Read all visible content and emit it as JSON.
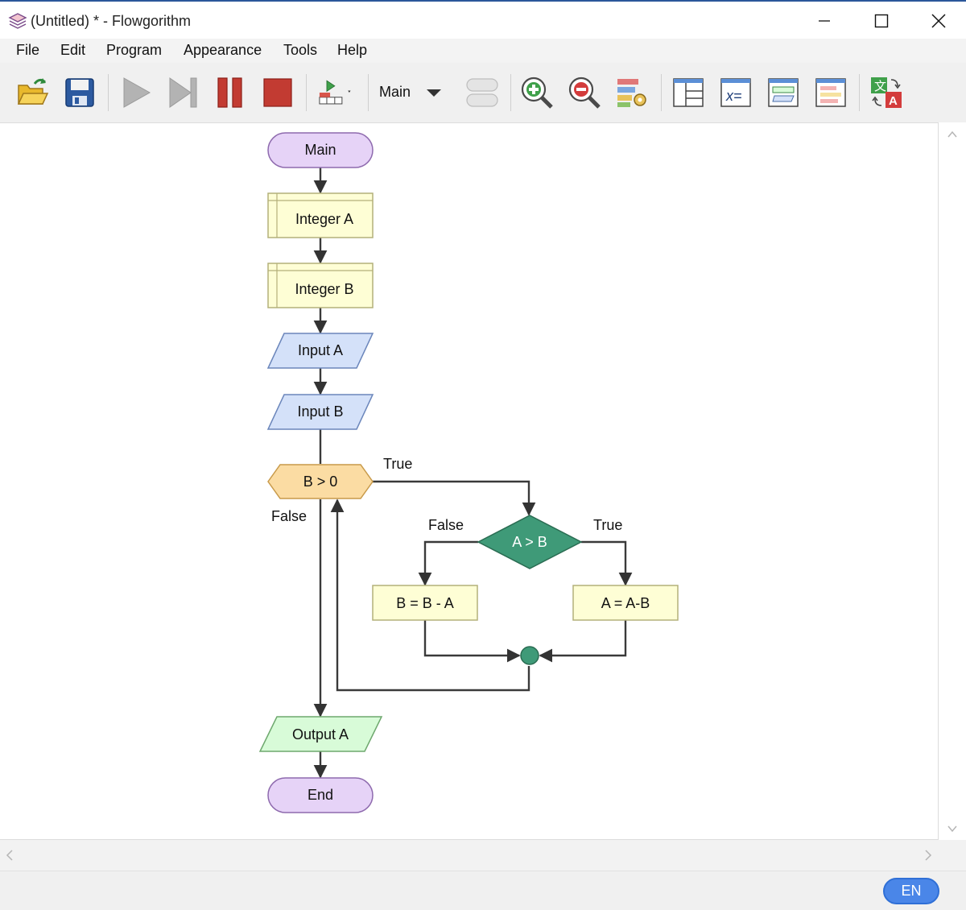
{
  "window": {
    "title": "(Untitled) * - Flowgorithm"
  },
  "menu": {
    "items": [
      "File",
      "Edit",
      "Program",
      "Appearance",
      "Tools",
      "Help"
    ]
  },
  "toolbar": {
    "buttons": [
      "open-icon",
      "save-icon",
      "run-icon",
      "step-icon",
      "pause-icon",
      "stop-icon",
      "run-speed-icon",
      "toggle-view-icon",
      "zoom-in-icon",
      "zoom-out-icon",
      "layout-settings-icon",
      "layout-windows-icon",
      "variable-watch-icon",
      "console-icon",
      "source-code-icon",
      "translate-icon"
    ],
    "function_select": "Main"
  },
  "flowchart": {
    "start": "Main",
    "declare_a": "Integer A",
    "declare_b": "Integer B",
    "input_a": "Input A",
    "input_b": "Input B",
    "loop_condition": "B > 0",
    "loop_true_label": "True",
    "loop_false_label": "False",
    "if_condition": "A > B",
    "if_false_label": "False",
    "if_true_label": "True",
    "assign_false": "B = B - A",
    "assign_true": "A = A-B",
    "output": "Output A",
    "end": "End"
  },
  "colors": {
    "terminal": "#e6d3f7",
    "declare": "#fefed5",
    "input": "#d4e1f9",
    "loop": "#fbdca3",
    "if": "#3f9a78",
    "output": "#d8fbd8",
    "badge": "#4a86e8"
  },
  "status": {
    "language": "EN"
  }
}
